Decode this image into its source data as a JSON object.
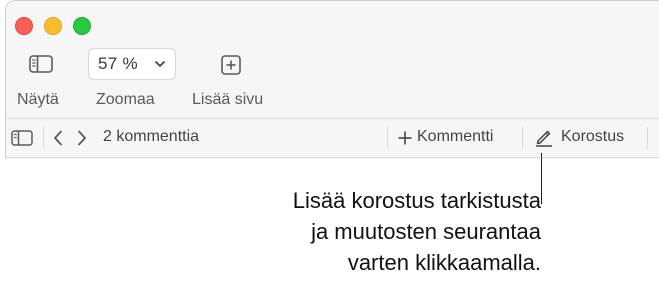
{
  "window": {
    "controls": [
      "close",
      "minimize",
      "zoom"
    ]
  },
  "toolbar": {
    "view": {
      "label": "Näytä",
      "icon": "sidebar-icon"
    },
    "zoom": {
      "label": "Zoomaa",
      "value": "57 %",
      "icon": "chevron-down-icon"
    },
    "add_page": {
      "label": "Lisää sivu",
      "icon": "plus-square-icon"
    }
  },
  "comments_bar": {
    "count_text": "2 kommenttia",
    "add_comment_label": "Kommentti",
    "highlight_label": "Korostus"
  },
  "callout": {
    "lines": [
      "Lisää korostus tarkistusta",
      "ja muutosten seurantaa",
      "varten klikkaamalla."
    ]
  },
  "colors": {
    "close": "#fe5f57",
    "minimize": "#febc2e",
    "zoom": "#28c840",
    "toolbar_bg": "#f6f6f6"
  }
}
